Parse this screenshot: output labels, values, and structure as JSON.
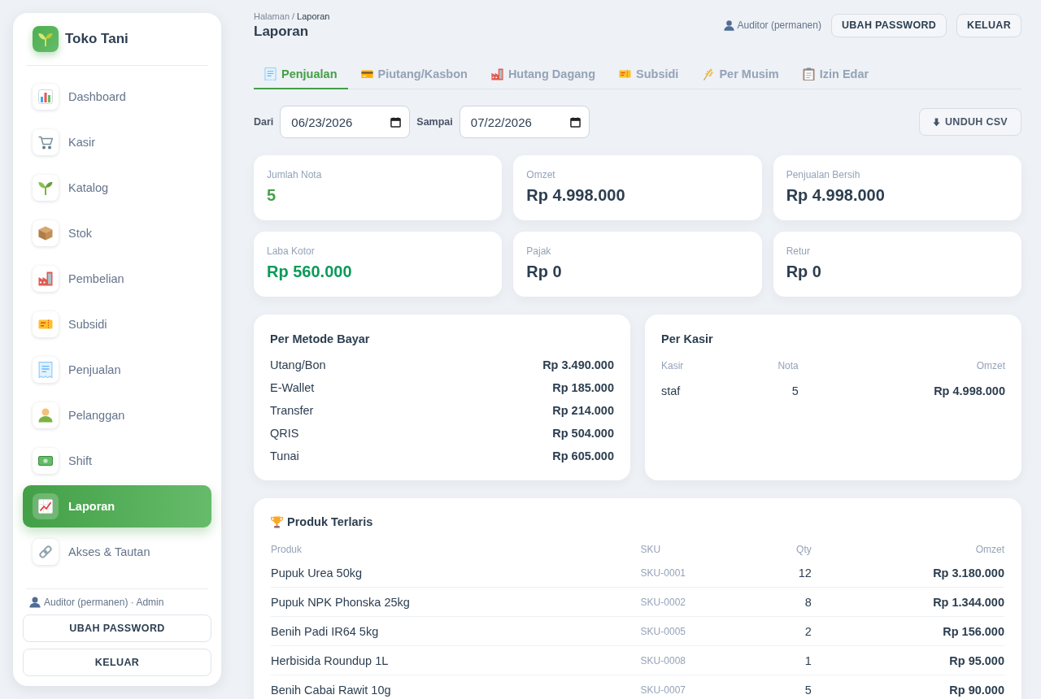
{
  "sidebar": {
    "brand": "Toko Tani",
    "nav_items": [
      {
        "label": "Dashboard",
        "selected": false
      },
      {
        "label": "Kasir",
        "selected": false
      },
      {
        "label": "Katalog",
        "selected": false
      },
      {
        "label": "Stok",
        "selected": false
      },
      {
        "label": "Pembelian",
        "selected": false
      },
      {
        "label": "Subsidi",
        "selected": false
      },
      {
        "label": "Penjualan",
        "selected": false
      },
      {
        "label": "Pelanggan",
        "selected": false
      },
      {
        "label": "Shift",
        "selected": false
      },
      {
        "label": "Laporan",
        "selected": true
      },
      {
        "label": "Akses & Tautan",
        "selected": false
      }
    ],
    "user": "Auditor (permanen) · Admin",
    "buttons": [
      "UBAH PASSWORD",
      "KELUAR"
    ]
  },
  "header": {
    "breadcrumb": [
      "Halaman",
      "Laporan"
    ],
    "breadcrumb_separator": "/",
    "title": "Laporan",
    "user": "Auditor (permanen)",
    "buttons": [
      "UBAH PASSWORD",
      "KELUAR"
    ]
  },
  "tabs": [
    {
      "label": "Penjualan",
      "selected": true
    },
    {
      "label": "Piutang/Kasbon",
      "selected": false
    },
    {
      "label": "Hutang Dagang",
      "selected": false
    },
    {
      "label": "Subsidi",
      "selected": false
    },
    {
      "label": "Per Musim",
      "selected": false
    },
    {
      "label": "Izin Edar",
      "selected": false
    }
  ],
  "filters": {
    "from": {
      "label": "Dari",
      "value": "06/23/2026"
    },
    "to": {
      "label": "Sampai",
      "value": "07/22/2026"
    },
    "export_button": "UNDUH CSV"
  },
  "stats": [
    {
      "label": "Jumlah Nota",
      "value": "5",
      "color": "#43a047"
    },
    {
      "label": "Omzet",
      "value": "Rp 4.998.000",
      "color": "#2c3e50"
    },
    {
      "label": "Penjualan Bersih",
      "value": "Rp 4.998.000",
      "color": "#2c3e50"
    },
    {
      "label": "Laba Kotor",
      "value": "Rp 560.000",
      "color": "#0b9a5a"
    },
    {
      "label": "Pajak",
      "value": "Rp 0",
      "color": "#2c3e50"
    },
    {
      "label": "Retur",
      "value": "Rp 0",
      "color": "#2c3e50"
    }
  ],
  "per_payment_method": {
    "title": "Per Metode Bayar",
    "rows": [
      {
        "method": "Utang/Bon",
        "amount": "Rp 3.490.000"
      },
      {
        "method": "E-Wallet",
        "amount": "Rp 185.000"
      },
      {
        "method": "Transfer",
        "amount": "Rp 214.000"
      },
      {
        "method": "QRIS",
        "amount": "Rp 504.000"
      },
      {
        "method": "Tunai",
        "amount": "Rp 605.000"
      }
    ]
  },
  "per_cashier": {
    "title": "Per Kasir",
    "columns": [
      "Kasir",
      "Nota",
      "Omzet"
    ],
    "rows": [
      [
        "staf",
        "5",
        "Rp 4.998.000"
      ]
    ]
  },
  "top_products": {
    "title": "Produk Terlaris",
    "columns": [
      "Produk",
      "SKU",
      "Qty",
      "Omzet"
    ],
    "rows": [
      [
        "Pupuk Urea 50kg",
        "SKU-0001",
        "12",
        "Rp 3.180.000"
      ],
      [
        "Pupuk NPK Phonska 25kg",
        "SKU-0002",
        "8",
        "Rp 1.344.000"
      ],
      [
        "Benih Padi IR64 5kg",
        "SKU-0005",
        "2",
        "Rp 156.000"
      ],
      [
        "Herbisida Roundup 1L",
        "SKU-0008",
        "1",
        "Rp 95.000"
      ],
      [
        "Benih Cabai Rawit 10g",
        "SKU-0007",
        "5",
        "Rp 90.000"
      ]
    ]
  }
}
